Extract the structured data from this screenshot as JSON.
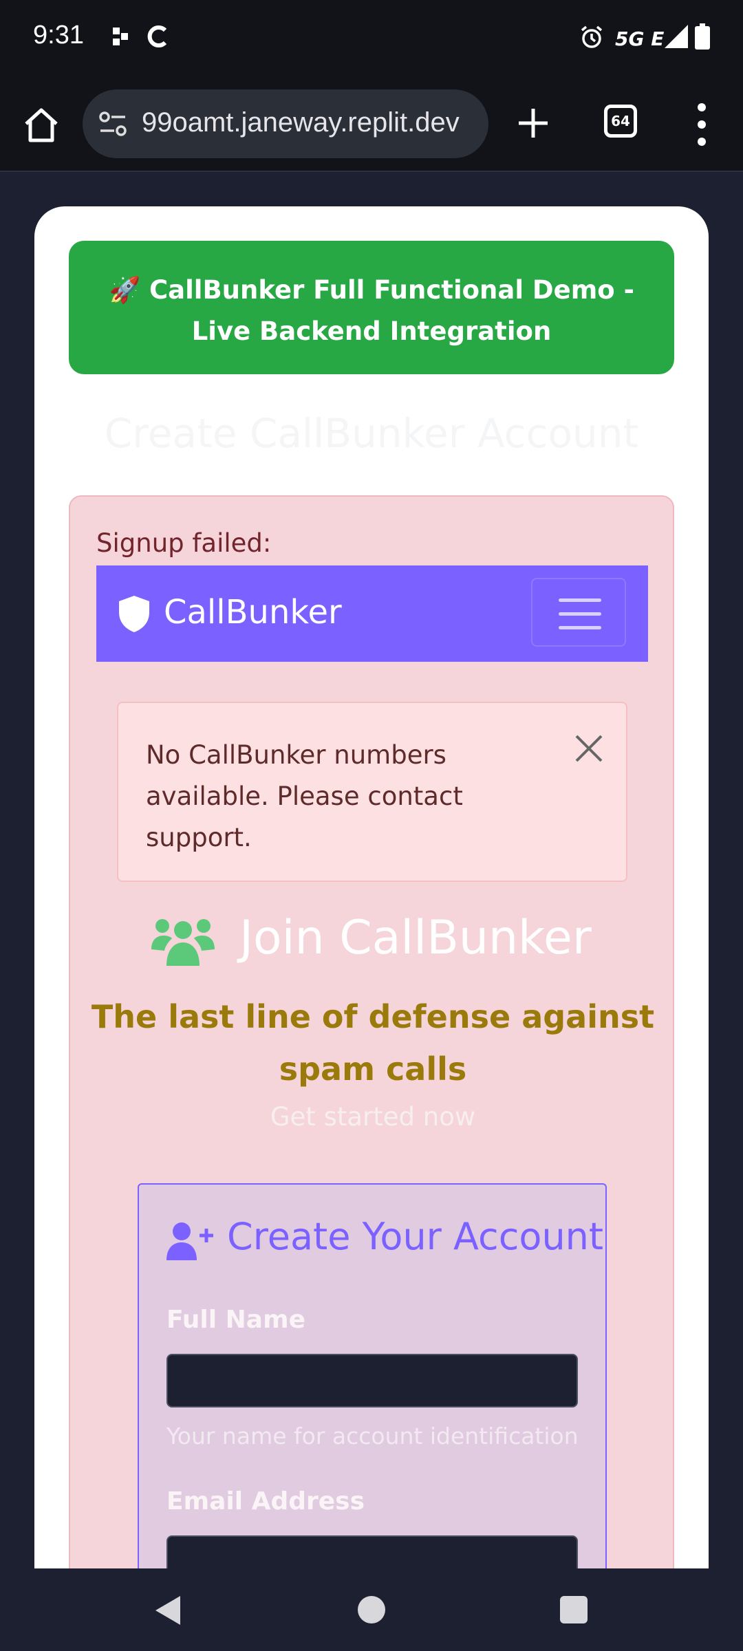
{
  "status": {
    "time": "9:31",
    "network": "5G E"
  },
  "browser": {
    "url": "99oamt.janeway.replit.dev",
    "tab_count": "64"
  },
  "page": {
    "demo_banner": "🚀 CallBunker Full Functional Demo - Live Backend Integration",
    "faint_title": "Create CallBunker Account",
    "error_label": "Signup failed:",
    "navbar": {
      "brand": "CallBunker"
    },
    "alert": {
      "message": "No CallBunker numbers available. Please contact support."
    },
    "join_title": "Join CallBunker",
    "tagline": "The last line of defense against spam calls",
    "get_started": "Get started now",
    "form": {
      "title": "Create Your Account",
      "full_name_label": "Full Name",
      "full_name_value": "",
      "full_name_hint": "Your name for account identification",
      "email_label": "Email Address",
      "email_value": ""
    }
  },
  "colors": {
    "banner_green": "#28a745",
    "brand_purple": "#7b61ff",
    "error_bg": "#f5d5d9",
    "tagline_gold": "#9a7a0a"
  }
}
